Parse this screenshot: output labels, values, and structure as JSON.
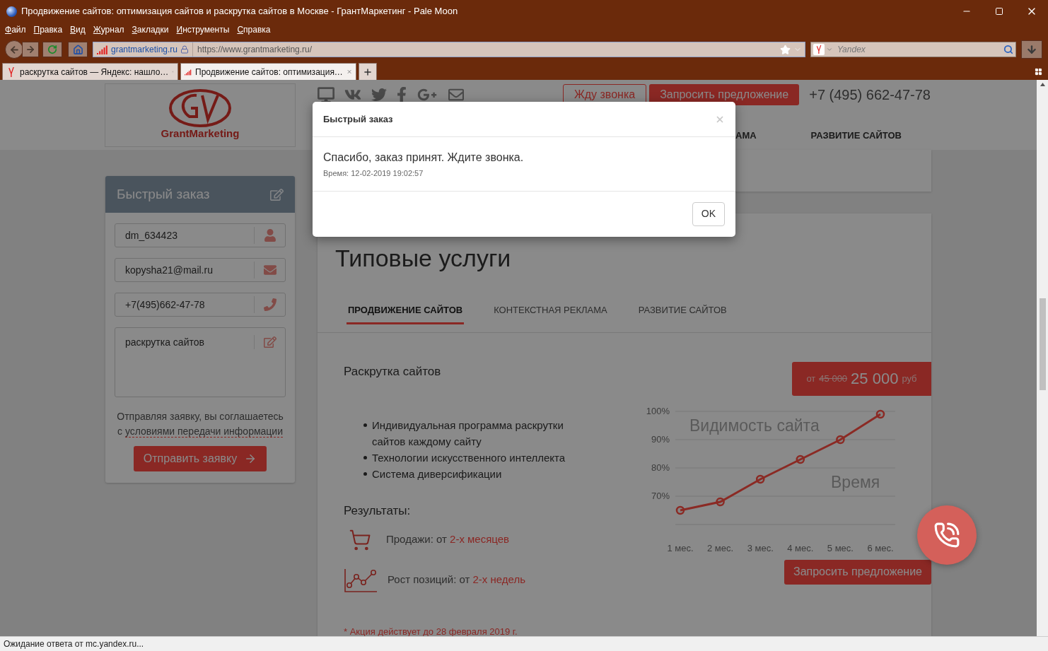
{
  "window": {
    "title": "Продвижение сайтов: оптимизация сайтов и раскрутка сайтов в Москве - ГрантМаркетинг - Pale Moon"
  },
  "menu": [
    "Файл",
    "Правка",
    "Вид",
    "Журнал",
    "Закладки",
    "Инструменты",
    "Справка"
  ],
  "toolbar": {
    "site_identity": "grantmarketing.ru",
    "url": "https://www.grantmarketing.ru/",
    "search": {
      "placeholder": "Yandex"
    }
  },
  "tabs": [
    {
      "title": "раскрутка сайтов — Яндекс: нашло…",
      "kind": "yandex",
      "selected": false
    },
    {
      "title": "Продвижение сайтов: оптимизация…",
      "kind": "site",
      "selected": true
    }
  ],
  "header": {
    "logo_text": "GrantMarketing",
    "buttons": [
      {
        "label": "Жду звонка",
        "kind": "outline"
      },
      {
        "label": "Запросить предложение",
        "kind": "solid"
      }
    ],
    "phone": "+7 (495) 662-47-78",
    "nav": [
      "АМА",
      "РАЗВИТИЕ САЙТОВ"
    ]
  },
  "sidebar": {
    "title": "Быстрый заказ",
    "fields": [
      {
        "value": "dm_634423",
        "kind": "user"
      },
      {
        "value": "kopysha21@mail.ru",
        "kind": "email"
      },
      {
        "value": "+7(495)662-47-78",
        "kind": "phone"
      },
      {
        "value": "раскрутка сайтов",
        "kind": "message"
      }
    ],
    "consent": {
      "text": "Отправляя заявку, вы соглашаетесь с",
      "link": "условиями передачи информации"
    },
    "submit": "Отправить заявку"
  },
  "services": {
    "title": "Типовые услуги",
    "tabs": [
      {
        "label": "ПРОДВИЖЕНИЕ САЙТОВ",
        "selected": true
      },
      {
        "label": "КОНТЕКСТНАЯ РЕКЛАМА",
        "selected": false
      },
      {
        "label": "РАЗВИТИЕ САЙТОВ",
        "selected": false
      }
    ],
    "service": {
      "name": "Раскрутка сайтов",
      "price": {
        "prefix": "от",
        "old": "45 000",
        "value": "25 000",
        "currency": "руб"
      },
      "features": [
        "Индивидуальная программа раскрутки сайтов каждому сайту",
        "Технологии искусственного интеллекта",
        "Система диверсификации"
      ],
      "results_title": "Результаты:",
      "results": [
        {
          "kind": "cart",
          "text": "Продажи: от",
          "highlight": "2-х месяцев"
        },
        {
          "kind": "growth",
          "text": "Рост позиций: от",
          "highlight": "2-х недель"
        }
      ],
      "chart_data": {
        "type": "line",
        "xlabel": "Время",
        "ylabel": "Видимость сайта",
        "categories": [
          "1 мес.",
          "2 мес.",
          "3 мес.",
          "4 мес.",
          "5 мес.",
          "6 мес."
        ],
        "series": [
          {
            "color": "#8b2a24",
            "marker": "circle",
            "values": [
              65,
              68,
              76,
              83,
              90,
              99
            ]
          }
        ],
        "grid": true,
        "ylim": [
          60,
          100
        ],
        "yticks": [
          {
            "value": 70,
            "label": "70%"
          },
          {
            "value": 80,
            "label": "80%"
          },
          {
            "value": 90,
            "label": "90%"
          },
          {
            "value": 100,
            "label": "100%"
          }
        ]
      },
      "cta": "Запросить предложение"
    },
    "note": "* Акция действует до 28 февраля 2019 г."
  },
  "dialog": {
    "title": "Быстрый заказ",
    "message": "Спасибо, заказ принят. Ждите звонка.",
    "time": "Время: 12-02-2019 19:02:57",
    "button": "OK"
  },
  "status_bar": "Ожидание ответа от mc.yandex.ru..."
}
